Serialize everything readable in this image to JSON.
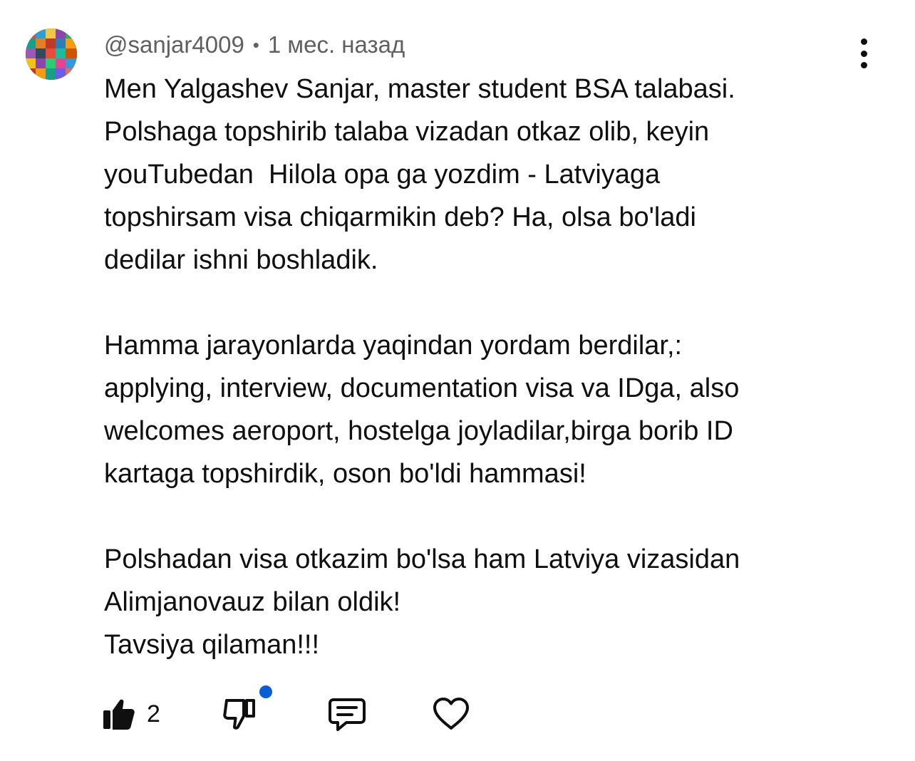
{
  "comment": {
    "author": "@sanjar4009",
    "separator": "•",
    "timestamp": "1 мес. назад",
    "paragraphs": [
      "Men Yalgashev Sanjar, master student BSA talabasi.\nPolshaga topshirib talaba vizadan otkaz olib, keyin\nyouTubedan  Hilola opa ga yozdim - Latviyaga\ntopshirsam visa chiqarmikin deb? Ha, olsa bo'ladi\ndedilar ishni boshladik.",
      "Hamma jarayonlarda yaqindan yordam berdilar,:\napplying, interview, documentation visa va IDga, also\nwelcomes aeroport, hostelga joyladilar,birga borib ID\nkartaga topshirdik, oson bo'ldi hammasi!",
      "Polshadan visa otkazim bo'lsa ham Latviya vizasidan\nAlimjanovauz bilan oldik!\nTavsiya qilaman!!!"
    ]
  },
  "actions": {
    "like_count": "2",
    "like_icon": "thumbs-up-filled-icon",
    "dislike_icon": "thumbs-down-outline-icon",
    "reply_icon": "comment-reply-icon",
    "heart_icon": "heart-outline-icon",
    "more_icon": "vertical-ellipsis-icon",
    "notification_dot_color": "#065fd4"
  }
}
